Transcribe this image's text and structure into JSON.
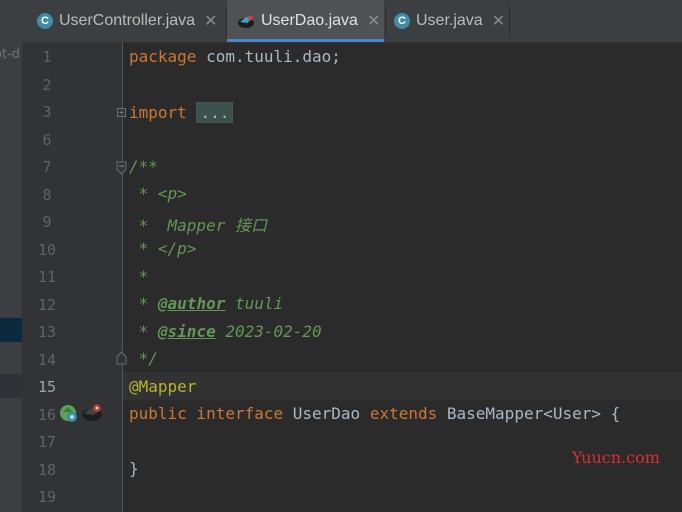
{
  "tabs": [
    {
      "label": "UserController.java",
      "icon": "class-icon",
      "icon_letter": "C",
      "close": "✕",
      "active": false
    },
    {
      "label": "UserDao.java",
      "icon": "interface-icon",
      "close": "✕",
      "active": true
    },
    {
      "label": "User.java",
      "icon": "class-icon",
      "icon_letter": "C",
      "close": "✕",
      "active": false
    }
  ],
  "left_panel": {
    "crumb_text": "ot-d"
  },
  "line_numbers": [
    "1",
    "2",
    "3",
    "6",
    "7",
    "8",
    "9",
    "10",
    "11",
    "12",
    "13",
    "14",
    "15",
    "16",
    "17",
    "18",
    "19"
  ],
  "current_line": "15",
  "code": {
    "l1_kw": "package",
    "l1_rest": " com.tuuli.dao;",
    "l3_kw": "import",
    "l3_dots": "...",
    "l7": "/**",
    "l8_prefix": " * ",
    "l8_tag": "<p>",
    "l9": " *  Mapper 接口",
    "l10_prefix": " * ",
    "l10_tag": "</p>",
    "l11": " *",
    "l12_prefix": " * ",
    "l12_tag": "@author",
    "l12_val": " tuuli",
    "l13_prefix": " * ",
    "l13_tag": "@since",
    "l13_val": " 2023-02-20",
    "l14": " */",
    "l15_ann": "@Mapper",
    "l16_kw1": "public",
    "l16_kw2": " interface",
    "l16_name": " UserDao",
    "l16_kw3": " extends",
    "l16_rest": " BaseMapper<User> {",
    "l18": "}"
  },
  "watermark": "Yuucn.com",
  "colors": {
    "keyword": "#cc7832",
    "annotation": "#bbb529",
    "javadoc": "#629755",
    "text": "#a9b7c6",
    "accent": "#4a88c7"
  }
}
